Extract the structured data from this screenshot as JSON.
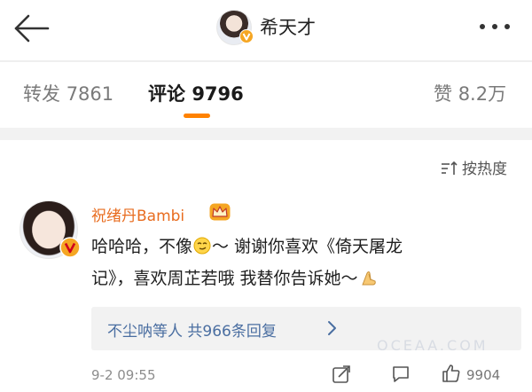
{
  "header": {
    "title": "希天才",
    "back_icon": "arrow-left-icon",
    "more_icon": "more-dots-icon",
    "verified_icon": "verified-v-icon"
  },
  "tabs": [
    {
      "label": "转发",
      "count": "7861"
    },
    {
      "label": "评论",
      "count": "9796",
      "active": true
    },
    {
      "label": "赞",
      "count": "8.2万"
    }
  ],
  "colors": {
    "accent": "#ff8200",
    "username": "#e86c1f",
    "link": "#4a6ea1",
    "badge": "#f5a623"
  },
  "sort": {
    "label": "按热度",
    "icon": "sort-icon"
  },
  "comment": {
    "username": "祝绪丹Bambi",
    "badge_icon": "crown-icon",
    "text_line1_a": "哈哈哈，不像",
    "text_line1_b": "～ 谢谢你喜欢《倚天屠龙",
    "text_line2": "记》，喜欢周芷若哦 我替你告诉她～",
    "emoji1": "smirk-emoji",
    "emoji2": "pray-emoji",
    "replies_text": "不尘呐等人  共966条回复",
    "time": "9-2 09:55",
    "like_count": "9904"
  },
  "watermark": "OCEAA.COM"
}
